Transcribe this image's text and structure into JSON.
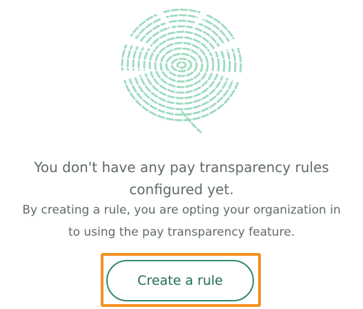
{
  "empty_state": {
    "illustration_icon": "leaf-fingerprint-icon",
    "illustration_color": "#9fdcc2",
    "headline_line1": "You don't have any pay transparency rules",
    "headline_line2": "configured yet.",
    "body_line1": "By creating a rule, you are opting your organization in",
    "body_line2": "to using the pay transparency feature.",
    "create_button_label": "Create a rule"
  },
  "colors": {
    "text": "#5f6b68",
    "button_border": "#2f8a63",
    "button_text": "#1e6e4e",
    "focus_outline": "#f5901e"
  }
}
